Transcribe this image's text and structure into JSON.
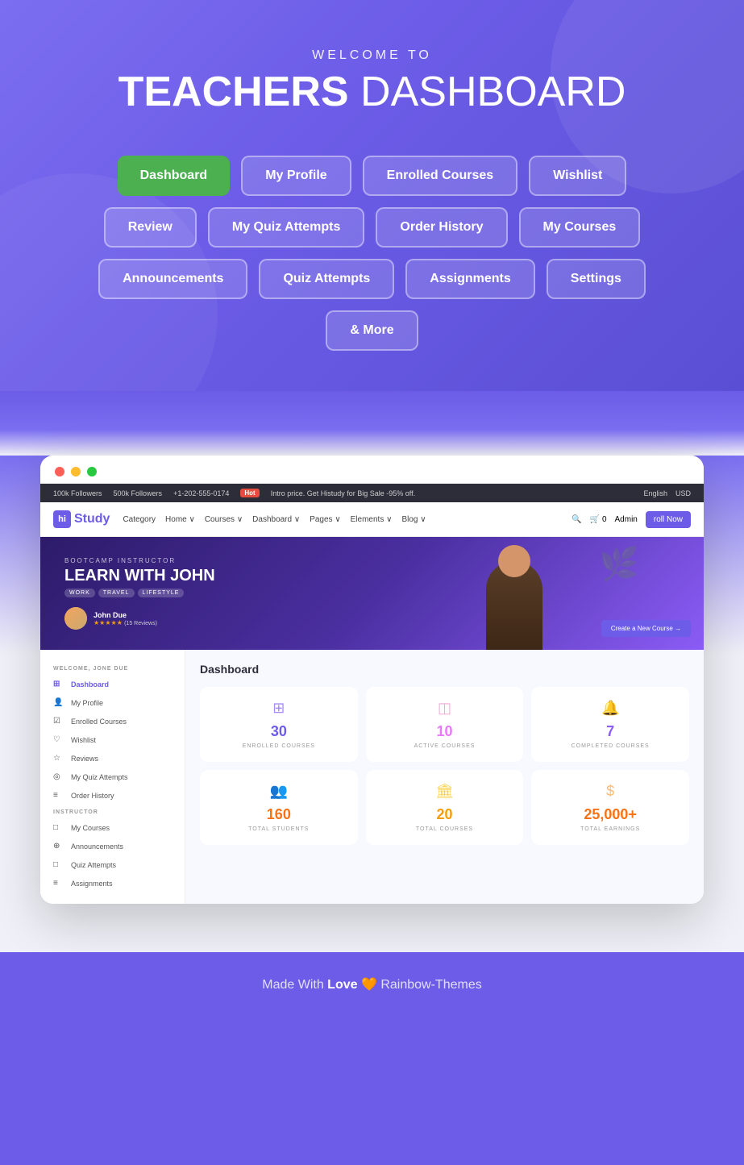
{
  "hero": {
    "subtitle": "WELCOME TO",
    "title_bold": "TEACHERS",
    "title_regular": " DASHBOARD"
  },
  "nav_buttons": [
    {
      "label": "Dashboard",
      "state": "active"
    },
    {
      "label": "My Profile",
      "state": "default"
    },
    {
      "label": "Enrolled Courses",
      "state": "default"
    },
    {
      "label": "Wishlist",
      "state": "default"
    },
    {
      "label": "Review",
      "state": "default"
    },
    {
      "label": "My Quiz Attempts",
      "state": "default"
    },
    {
      "label": "Order History",
      "state": "default"
    },
    {
      "label": "My Courses",
      "state": "default"
    },
    {
      "label": "Announcements",
      "state": "default"
    },
    {
      "label": "Quiz Attempts",
      "state": "default"
    },
    {
      "label": "Assignments",
      "state": "default"
    },
    {
      "label": "Settings",
      "state": "default"
    },
    {
      "label": "& More",
      "state": "default"
    }
  ],
  "topbar": {
    "followers_fb": "100k Followers",
    "followers_in": "500k Followers",
    "phone": "+1-202-555-0174",
    "hot": "Hot",
    "promo": "Intro price. Get Histudy for Big Sale -95% off.",
    "lang": "English",
    "currency": "USD"
  },
  "navbar": {
    "logo": "Study",
    "logo_prefix": "hi",
    "items": [
      "Category",
      "Home",
      "Courses",
      "Dashboard",
      "Pages",
      "Elements",
      "Blog"
    ],
    "admin": "Admin",
    "enroll_btn": "roll Now"
  },
  "banner": {
    "label": "BOOTCAMP INSTRUCTOR",
    "name": "LEARN WITH JOHN",
    "tags": [
      "WORK",
      "TRAVEL",
      "LIFESTYLE"
    ],
    "instructor_name": "John Due",
    "reviews": "(15 Reviews)",
    "create_btn": "Create a New Course →"
  },
  "sidebar": {
    "welcome": "WELCOME, JONE DUE",
    "student_items": [
      {
        "icon": "⊞",
        "label": "Dashboard",
        "active": true
      },
      {
        "icon": "👤",
        "label": "My Profile",
        "active": false
      },
      {
        "icon": "☑",
        "label": "Enrolled Courses",
        "active": false
      },
      {
        "icon": "♡",
        "label": "Wishlist",
        "active": false
      },
      {
        "icon": "☆",
        "label": "Reviews",
        "active": false
      },
      {
        "icon": "◎",
        "label": "My Quiz Attempts",
        "active": false
      },
      {
        "icon": "≡",
        "label": "Order History",
        "active": false
      }
    ],
    "instructor_label": "INSTRUCTOR",
    "instructor_items": [
      {
        "icon": "□",
        "label": "My Courses",
        "active": false
      },
      {
        "icon": "⊕",
        "label": "Announcements",
        "active": false
      },
      {
        "icon": "□",
        "label": "Quiz Attempts",
        "active": false
      },
      {
        "icon": "≡",
        "label": "Assignments",
        "active": false
      }
    ]
  },
  "dashboard": {
    "title": "Dashboard",
    "stats_row1": [
      {
        "icon": "⊞",
        "number": "30",
        "label": "ENROLLED COURSES",
        "color": "purple"
      },
      {
        "icon": "◫",
        "number": "10",
        "label": "ACTIVE COURSES",
        "color": "pink"
      },
      {
        "icon": "🔔",
        "number": "7",
        "label": "COMPLETED COURSES",
        "color": "lavender"
      }
    ],
    "stats_row2": [
      {
        "icon": "👥",
        "number": "160",
        "label": "TOTAL STUDENTS",
        "color": "orange"
      },
      {
        "icon": "🏛",
        "number": "20",
        "label": "TOTAL COURSES",
        "color": "amber"
      },
      {
        "icon": "$",
        "number": "25,000+",
        "label": "TOTAL EARNINGS",
        "color": "orange"
      }
    ]
  },
  "footer": {
    "text_before": "Made With",
    "love": "Love",
    "heart": "🧡",
    "brand": "Rainbow-Themes"
  }
}
